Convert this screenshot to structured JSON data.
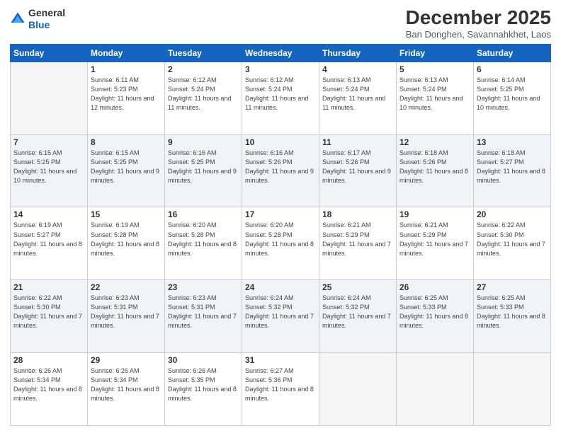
{
  "header": {
    "logo_general": "General",
    "logo_blue": "Blue",
    "month_title": "December 2025",
    "location": "Ban Donghen, Savannahkhet, Laos"
  },
  "days_of_week": [
    "Sunday",
    "Monday",
    "Tuesday",
    "Wednesday",
    "Thursday",
    "Friday",
    "Saturday"
  ],
  "weeks": [
    [
      {
        "day": "",
        "sunrise": "",
        "sunset": "",
        "daylight": ""
      },
      {
        "day": "1",
        "sunrise": "Sunrise: 6:11 AM",
        "sunset": "Sunset: 5:23 PM",
        "daylight": "Daylight: 11 hours and 12 minutes."
      },
      {
        "day": "2",
        "sunrise": "Sunrise: 6:12 AM",
        "sunset": "Sunset: 5:24 PM",
        "daylight": "Daylight: 11 hours and 11 minutes."
      },
      {
        "day": "3",
        "sunrise": "Sunrise: 6:12 AM",
        "sunset": "Sunset: 5:24 PM",
        "daylight": "Daylight: 11 hours and 11 minutes."
      },
      {
        "day": "4",
        "sunrise": "Sunrise: 6:13 AM",
        "sunset": "Sunset: 5:24 PM",
        "daylight": "Daylight: 11 hours and 11 minutes."
      },
      {
        "day": "5",
        "sunrise": "Sunrise: 6:13 AM",
        "sunset": "Sunset: 5:24 PM",
        "daylight": "Daylight: 11 hours and 10 minutes."
      },
      {
        "day": "6",
        "sunrise": "Sunrise: 6:14 AM",
        "sunset": "Sunset: 5:25 PM",
        "daylight": "Daylight: 11 hours and 10 minutes."
      }
    ],
    [
      {
        "day": "7",
        "sunrise": "Sunrise: 6:15 AM",
        "sunset": "Sunset: 5:25 PM",
        "daylight": "Daylight: 11 hours and 10 minutes."
      },
      {
        "day": "8",
        "sunrise": "Sunrise: 6:15 AM",
        "sunset": "Sunset: 5:25 PM",
        "daylight": "Daylight: 11 hours and 9 minutes."
      },
      {
        "day": "9",
        "sunrise": "Sunrise: 6:16 AM",
        "sunset": "Sunset: 5:25 PM",
        "daylight": "Daylight: 11 hours and 9 minutes."
      },
      {
        "day": "10",
        "sunrise": "Sunrise: 6:16 AM",
        "sunset": "Sunset: 5:26 PM",
        "daylight": "Daylight: 11 hours and 9 minutes."
      },
      {
        "day": "11",
        "sunrise": "Sunrise: 6:17 AM",
        "sunset": "Sunset: 5:26 PM",
        "daylight": "Daylight: 11 hours and 9 minutes."
      },
      {
        "day": "12",
        "sunrise": "Sunrise: 6:18 AM",
        "sunset": "Sunset: 5:26 PM",
        "daylight": "Daylight: 11 hours and 8 minutes."
      },
      {
        "day": "13",
        "sunrise": "Sunrise: 6:18 AM",
        "sunset": "Sunset: 5:27 PM",
        "daylight": "Daylight: 11 hours and 8 minutes."
      }
    ],
    [
      {
        "day": "14",
        "sunrise": "Sunrise: 6:19 AM",
        "sunset": "Sunset: 5:27 PM",
        "daylight": "Daylight: 11 hours and 8 minutes."
      },
      {
        "day": "15",
        "sunrise": "Sunrise: 6:19 AM",
        "sunset": "Sunset: 5:28 PM",
        "daylight": "Daylight: 11 hours and 8 minutes."
      },
      {
        "day": "16",
        "sunrise": "Sunrise: 6:20 AM",
        "sunset": "Sunset: 5:28 PM",
        "daylight": "Daylight: 11 hours and 8 minutes."
      },
      {
        "day": "17",
        "sunrise": "Sunrise: 6:20 AM",
        "sunset": "Sunset: 5:28 PM",
        "daylight": "Daylight: 11 hours and 8 minutes."
      },
      {
        "day": "18",
        "sunrise": "Sunrise: 6:21 AM",
        "sunset": "Sunset: 5:29 PM",
        "daylight": "Daylight: 11 hours and 7 minutes."
      },
      {
        "day": "19",
        "sunrise": "Sunrise: 6:21 AM",
        "sunset": "Sunset: 5:29 PM",
        "daylight": "Daylight: 11 hours and 7 minutes."
      },
      {
        "day": "20",
        "sunrise": "Sunrise: 6:22 AM",
        "sunset": "Sunset: 5:30 PM",
        "daylight": "Daylight: 11 hours and 7 minutes."
      }
    ],
    [
      {
        "day": "21",
        "sunrise": "Sunrise: 6:22 AM",
        "sunset": "Sunset: 5:30 PM",
        "daylight": "Daylight: 11 hours and 7 minutes."
      },
      {
        "day": "22",
        "sunrise": "Sunrise: 6:23 AM",
        "sunset": "Sunset: 5:31 PM",
        "daylight": "Daylight: 11 hours and 7 minutes."
      },
      {
        "day": "23",
        "sunrise": "Sunrise: 6:23 AM",
        "sunset": "Sunset: 5:31 PM",
        "daylight": "Daylight: 11 hours and 7 minutes."
      },
      {
        "day": "24",
        "sunrise": "Sunrise: 6:24 AM",
        "sunset": "Sunset: 5:32 PM",
        "daylight": "Daylight: 11 hours and 7 minutes."
      },
      {
        "day": "25",
        "sunrise": "Sunrise: 6:24 AM",
        "sunset": "Sunset: 5:32 PM",
        "daylight": "Daylight: 11 hours and 7 minutes."
      },
      {
        "day": "26",
        "sunrise": "Sunrise: 6:25 AM",
        "sunset": "Sunset: 5:33 PM",
        "daylight": "Daylight: 11 hours and 8 minutes."
      },
      {
        "day": "27",
        "sunrise": "Sunrise: 6:25 AM",
        "sunset": "Sunset: 5:33 PM",
        "daylight": "Daylight: 11 hours and 8 minutes."
      }
    ],
    [
      {
        "day": "28",
        "sunrise": "Sunrise: 6:26 AM",
        "sunset": "Sunset: 5:34 PM",
        "daylight": "Daylight: 11 hours and 8 minutes."
      },
      {
        "day": "29",
        "sunrise": "Sunrise: 6:26 AM",
        "sunset": "Sunset: 5:34 PM",
        "daylight": "Daylight: 11 hours and 8 minutes."
      },
      {
        "day": "30",
        "sunrise": "Sunrise: 6:26 AM",
        "sunset": "Sunset: 5:35 PM",
        "daylight": "Daylight: 11 hours and 8 minutes."
      },
      {
        "day": "31",
        "sunrise": "Sunrise: 6:27 AM",
        "sunset": "Sunset: 5:36 PM",
        "daylight": "Daylight: 11 hours and 8 minutes."
      },
      {
        "day": "",
        "sunrise": "",
        "sunset": "",
        "daylight": ""
      },
      {
        "day": "",
        "sunrise": "",
        "sunset": "",
        "daylight": ""
      },
      {
        "day": "",
        "sunrise": "",
        "sunset": "",
        "daylight": ""
      }
    ]
  ]
}
